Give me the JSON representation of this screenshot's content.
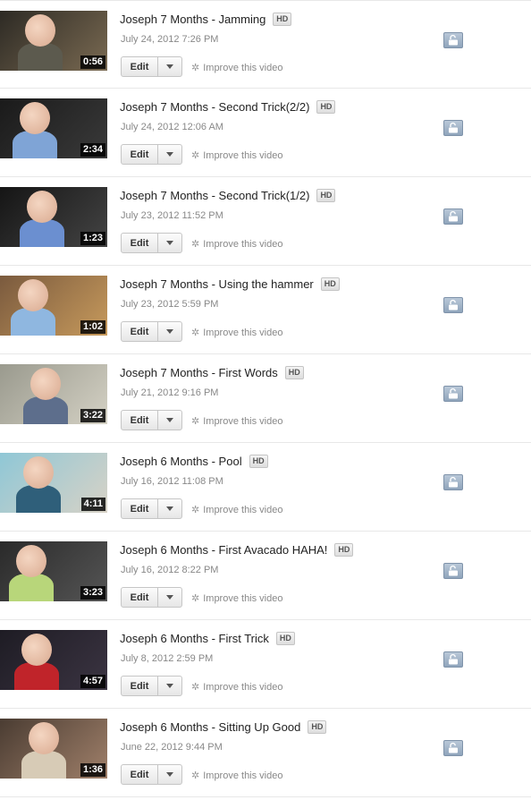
{
  "videos": [
    {
      "title": "Joseph 7 Months - Jamming",
      "hd": "HD",
      "date": "July 24, 2012 7:26 PM",
      "duration": "0:56",
      "edit": "Edit",
      "improve": "Improve this video",
      "thumb": {
        "bg1": "#2d2a24",
        "bg2": "#7a6a52",
        "shirt": "#5c5a4e"
      }
    },
    {
      "title": "Joseph 7 Months - Second Trick(2/2)",
      "hd": "HD",
      "date": "July 24, 2012 12:06 AM",
      "duration": "2:34",
      "edit": "Edit",
      "improve": "Improve this video",
      "thumb": {
        "bg1": "#1a1a1a",
        "bg2": "#3a3a3a",
        "shirt": "#7fa4d6"
      }
    },
    {
      "title": "Joseph 7 Months - Second Trick(1/2)",
      "hd": "HD",
      "date": "July 23, 2012 11:52 PM",
      "duration": "1:23",
      "edit": "Edit",
      "improve": "Improve this video",
      "thumb": {
        "bg1": "#151515",
        "bg2": "#444",
        "shirt": "#6b8fd0"
      }
    },
    {
      "title": "Joseph 7 Months - Using the hammer",
      "hd": "HD",
      "date": "July 23, 2012 5:59 PM",
      "duration": "1:02",
      "edit": "Edit",
      "improve": "Improve this video",
      "thumb": {
        "bg1": "#7a5a3e",
        "bg2": "#c79a5c",
        "shirt": "#8fb7e0"
      }
    },
    {
      "title": "Joseph 7 Months - First Words",
      "hd": "HD",
      "date": "July 21, 2012 9:16 PM",
      "duration": "3:22",
      "edit": "Edit",
      "improve": "Improve this video",
      "thumb": {
        "bg1": "#9a9a8e",
        "bg2": "#d4d1c4",
        "shirt": "#5d6e8c"
      }
    },
    {
      "title": "Joseph 6 Months - Pool",
      "hd": "HD",
      "date": "July 16, 2012 11:08 PM",
      "duration": "4:11",
      "edit": "Edit",
      "improve": "Improve this video",
      "thumb": {
        "bg1": "#8fc7d6",
        "bg2": "#d8d2c6",
        "shirt": "#2f5f7a"
      }
    },
    {
      "title": "Joseph 6 Months - First Avacado HAHA!",
      "hd": "HD",
      "date": "July 16, 2012 8:22 PM",
      "duration": "3:23",
      "edit": "Edit",
      "improve": "Improve this video",
      "thumb": {
        "bg1": "#2a2a2a",
        "bg2": "#555",
        "shirt": "#b8d67a"
      }
    },
    {
      "title": "Joseph 6 Months - First Trick",
      "hd": "HD",
      "date": "July 8, 2012 2:59 PM",
      "duration": "4:57",
      "edit": "Edit",
      "improve": "Improve this video",
      "thumb": {
        "bg1": "#1e1c24",
        "bg2": "#3b3442",
        "shirt": "#c0242a"
      }
    },
    {
      "title": "Joseph 6 Months - Sitting Up Good",
      "hd": "HD",
      "date": "June 22, 2012 9:44 PM",
      "duration": "1:36",
      "edit": "Edit",
      "improve": "Improve this video",
      "thumb": {
        "bg1": "#4a3c32",
        "bg2": "#a0806a",
        "shirt": "#d7cbb6"
      }
    }
  ],
  "icons": {
    "improve": "magic-wand-icon",
    "privacy": "unlocked-padlock-icon",
    "dropdown": "triangle-down-icon"
  },
  "colors": {
    "title": "#222222",
    "meta": "#888888",
    "privacy": "#8fa4bb"
  }
}
